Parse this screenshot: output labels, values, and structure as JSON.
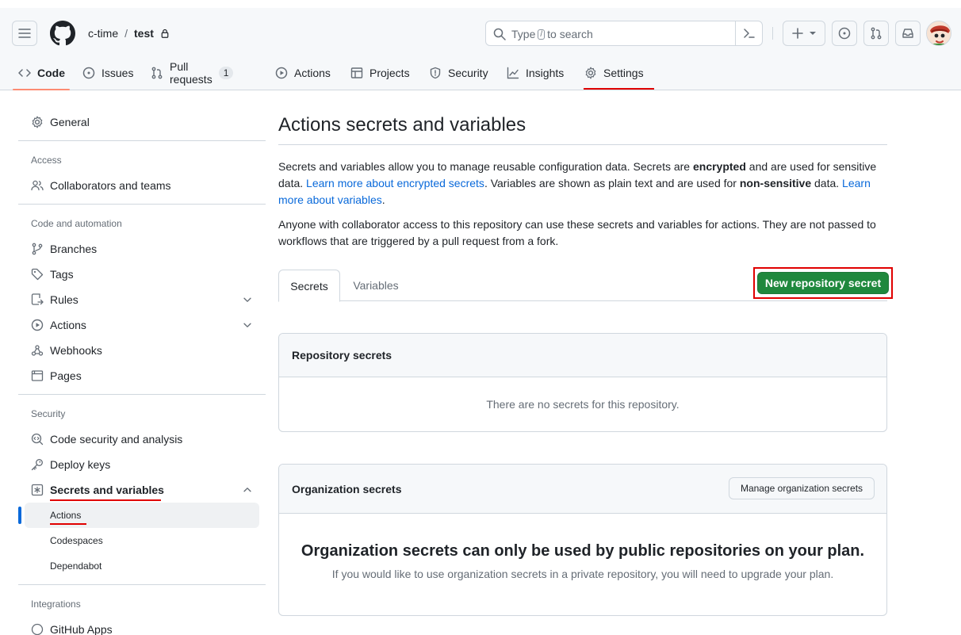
{
  "header": {
    "owner": "c-time",
    "separator": "/",
    "repo": "test",
    "search_prefix": "Type",
    "search_key": "/",
    "search_suffix": "to search"
  },
  "repo_tabs": [
    {
      "label": "Code",
      "icon": "code-icon",
      "selected": true
    },
    {
      "label": "Issues",
      "icon": "issue-opened-icon"
    },
    {
      "label": "Pull requests",
      "icon": "git-pull-request-icon",
      "count": "1"
    },
    {
      "label": "Actions",
      "icon": "play-icon"
    },
    {
      "label": "Projects",
      "icon": "table-icon"
    },
    {
      "label": "Security",
      "icon": "shield-icon"
    },
    {
      "label": "Insights",
      "icon": "graph-icon"
    },
    {
      "label": "Settings",
      "icon": "gear-icon"
    }
  ],
  "sidebar": {
    "general": "General",
    "access_heading": "Access",
    "collaborators": "Collaborators and teams",
    "code_automation_heading": "Code and automation",
    "branches": "Branches",
    "tags": "Tags",
    "rules": "Rules",
    "actions": "Actions",
    "webhooks": "Webhooks",
    "pages": "Pages",
    "security_heading": "Security",
    "code_security": "Code security and analysis",
    "deploy_keys": "Deploy keys",
    "secrets_variables": "Secrets and variables",
    "sub_actions": "Actions",
    "sub_codespaces": "Codespaces",
    "sub_dependabot": "Dependabot",
    "integrations_heading": "Integrations",
    "github_apps": "GitHub Apps"
  },
  "main": {
    "title": "Actions secrets and variables",
    "p1_a": "Secrets and variables allow you to manage reusable configuration data. Secrets are ",
    "p1_b": "encrypted",
    "p1_c": " and are used for sensitive data. ",
    "p1_link1": "Learn more about encrypted secrets",
    "p1_d": ". Variables are shown as plain text and are used for ",
    "p1_e": "non-sensitive",
    "p1_f": " data. ",
    "p1_link2": "Learn more about variables",
    "p1_g": ".",
    "p2": "Anyone with collaborator access to this repository can use these secrets and variables for actions. They are not passed to workflows that are triggered by a pull request from a fork.",
    "tab_secrets": "Secrets",
    "tab_variables": "Variables",
    "new_secret_button": "New repository secret",
    "repo_secrets_title": "Repository secrets",
    "repo_secrets_empty": "There are no secrets for this repository.",
    "org_secrets_title": "Organization secrets",
    "manage_org_button": "Manage organization secrets",
    "org_blank_title": "Organization secrets can only be used by public repositories on your plan.",
    "org_blank_sub": "If you would like to use organization secrets in a private repository, you will need to upgrade your plan."
  },
  "colors": {
    "primary_button": "#1f883d",
    "link": "#0969da",
    "highlight_annotation": "#e00000",
    "selected_tab_underline": "#fd8c73"
  }
}
